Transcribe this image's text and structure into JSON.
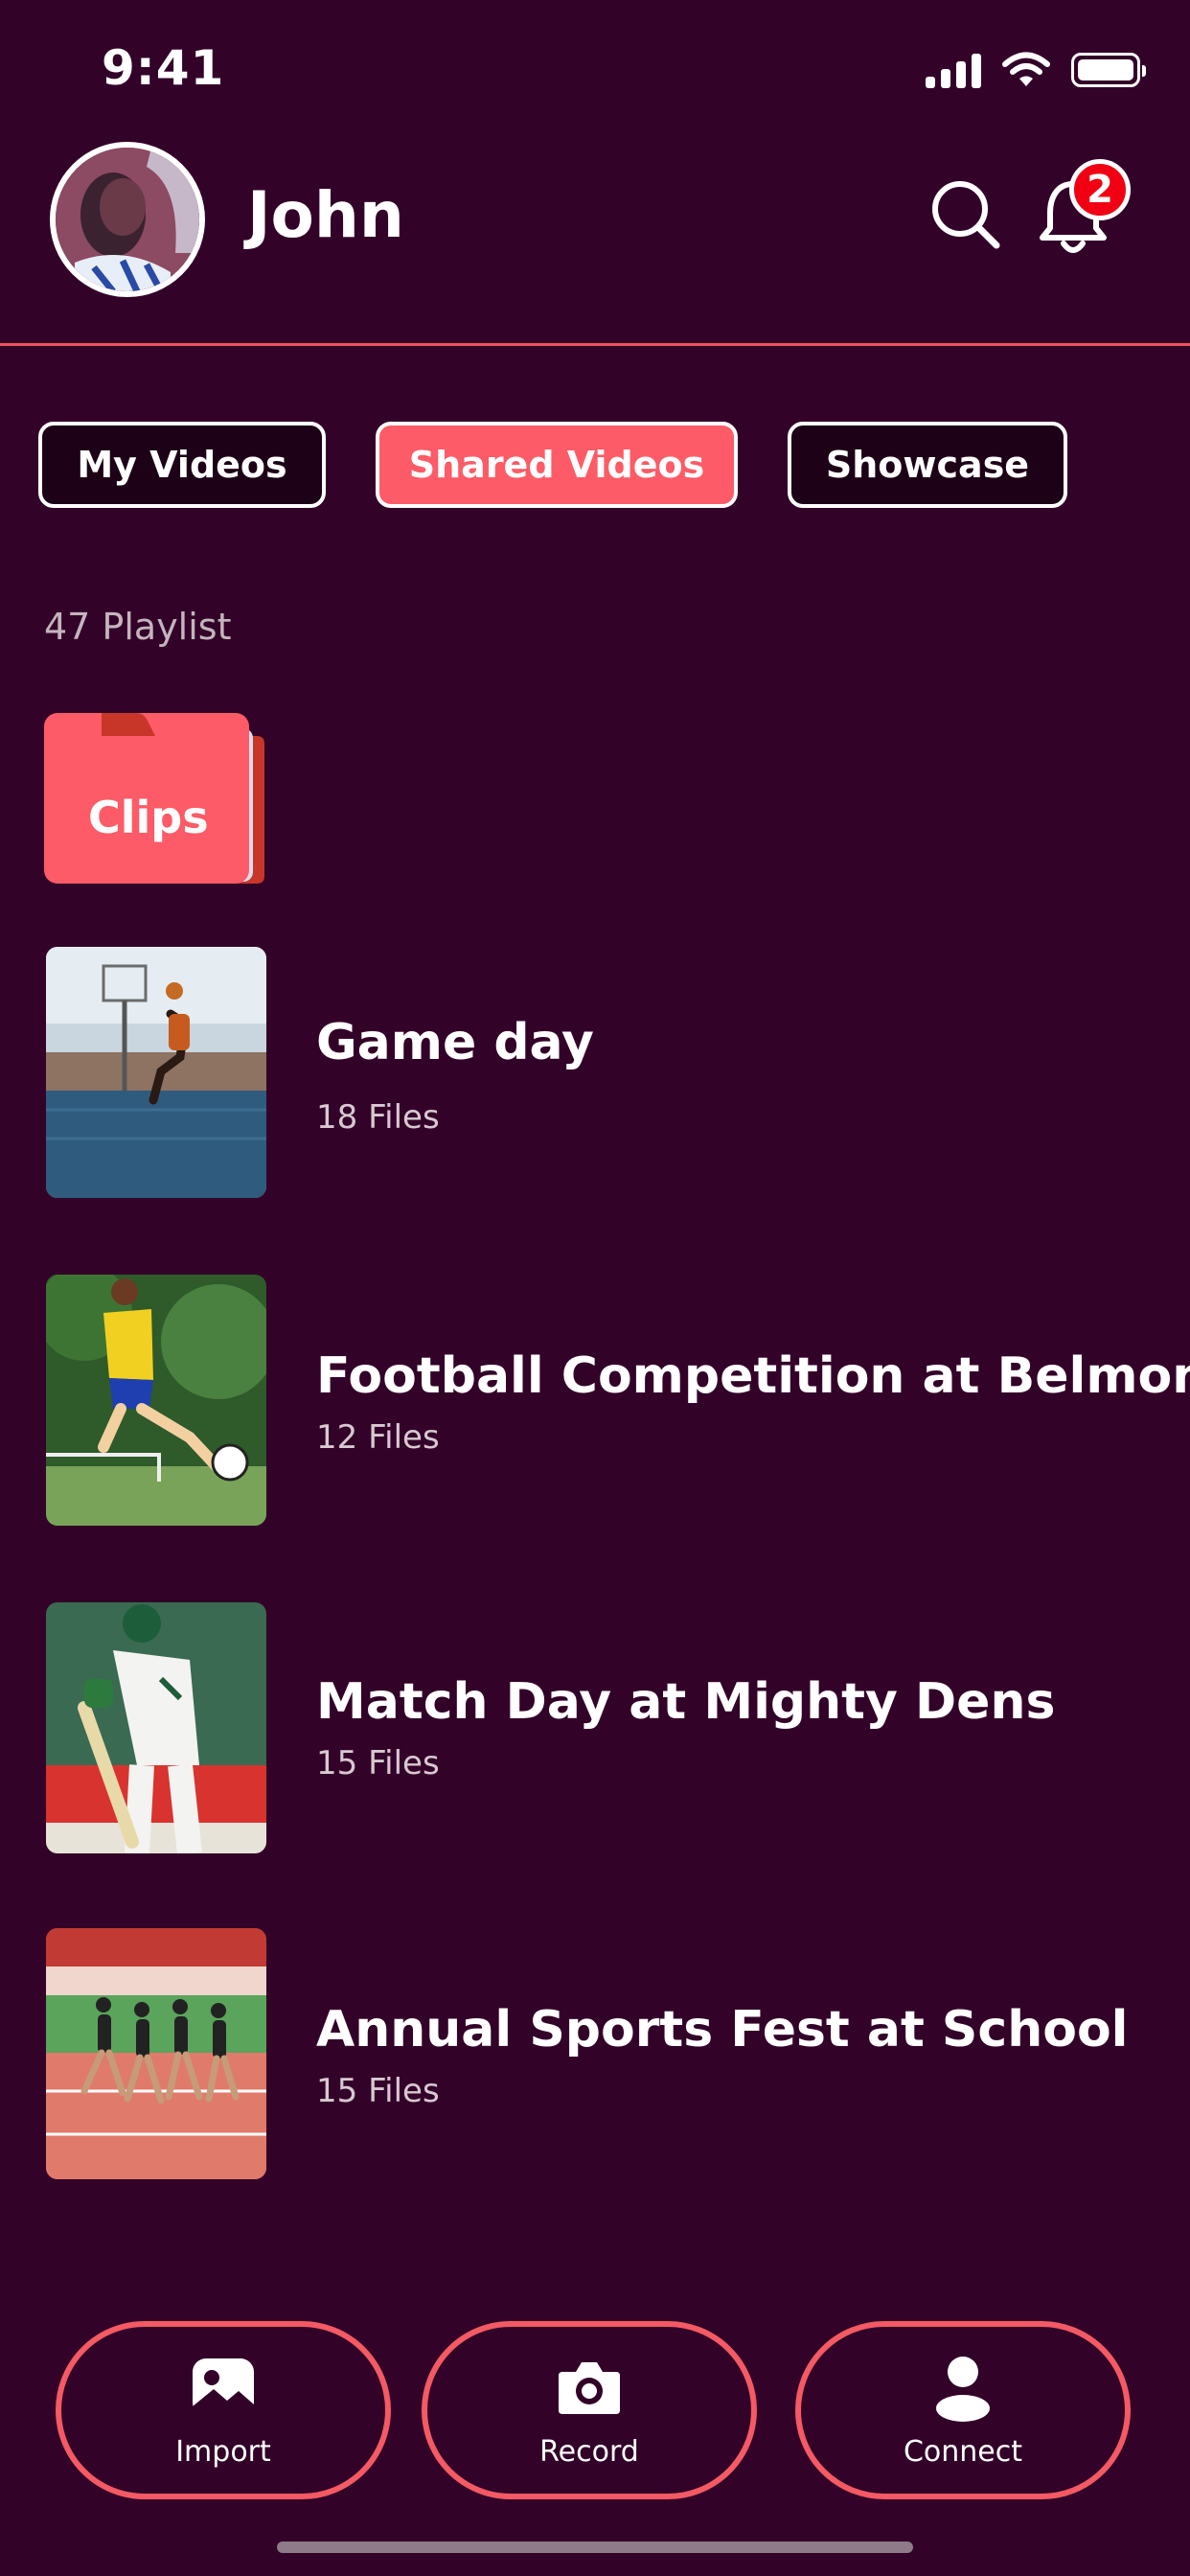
{
  "status_bar": {
    "time": "9:41"
  },
  "header": {
    "user_name": "John",
    "notification_count": "2"
  },
  "tabs": [
    {
      "label": "My Videos",
      "active": false
    },
    {
      "label": "Shared Videos",
      "active": true
    },
    {
      "label": "Showcase",
      "active": false
    }
  ],
  "playlist_count": "47 Playlist",
  "folder": {
    "label": "Clips"
  },
  "items": [
    {
      "title": "Game day",
      "files": "18 Files"
    },
    {
      "title": "Football Competition at Belmont",
      "files": "12 Files"
    },
    {
      "title": "Match Day at Mighty Dens",
      "files": "15 Files"
    },
    {
      "title": "Annual Sports Fest at School",
      "files": "15 Files"
    }
  ],
  "actions": [
    {
      "label": "Import",
      "icon": "image-icon"
    },
    {
      "label": "Record",
      "icon": "camera-icon"
    },
    {
      "label": "Connect",
      "icon": "person-icon"
    }
  ],
  "colors": {
    "background": "#330228",
    "accent": "#fd5b67",
    "divider": "#f0525b",
    "badge": "#f00012"
  }
}
